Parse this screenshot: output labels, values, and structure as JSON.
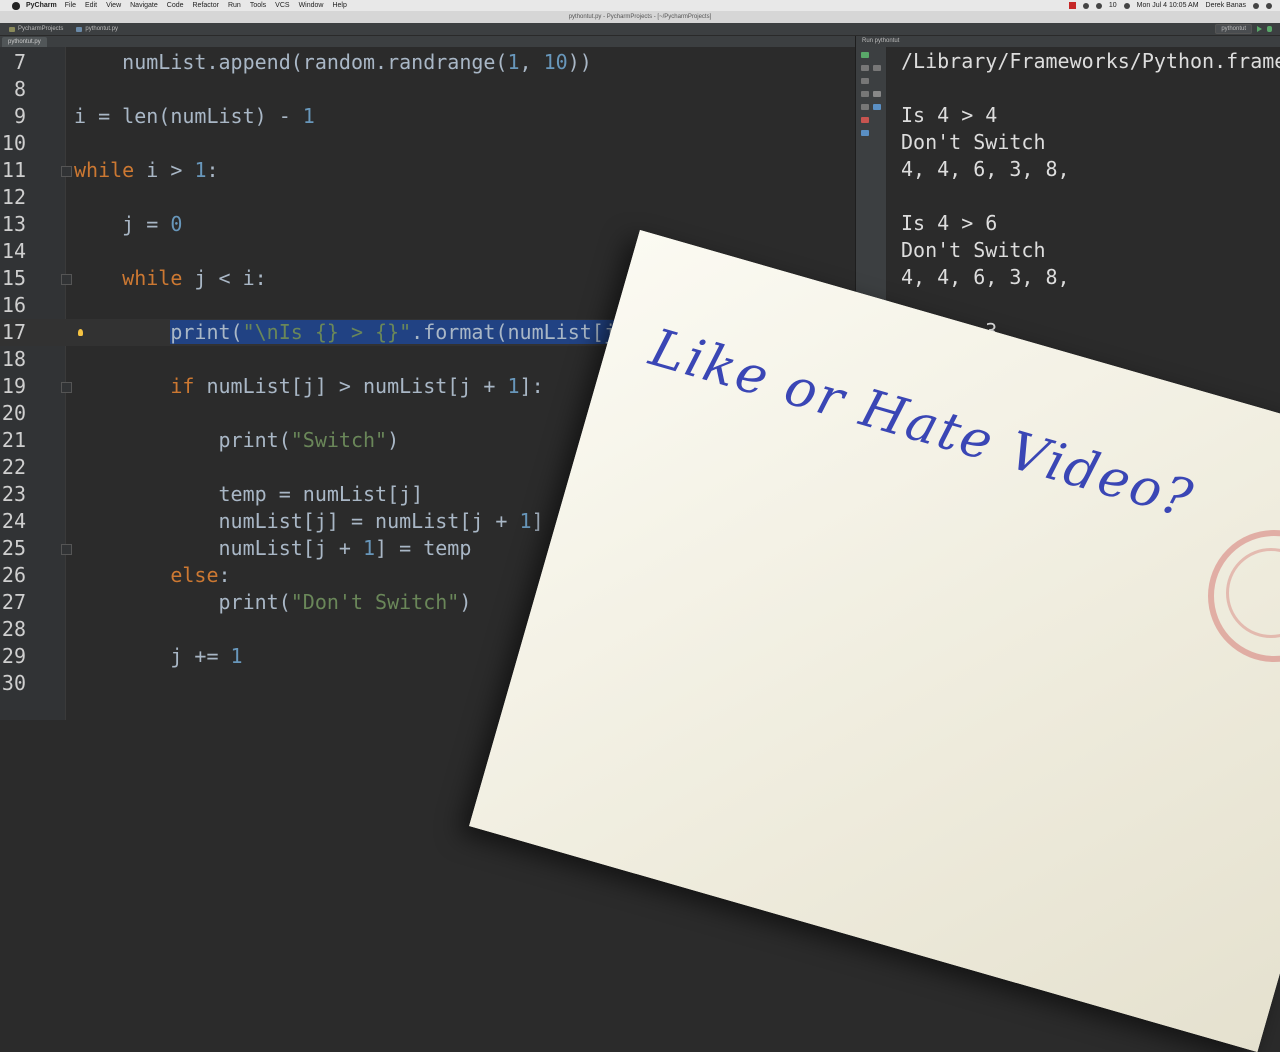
{
  "menubar": {
    "app": "PyCharm",
    "items": [
      "File",
      "Edit",
      "View",
      "Navigate",
      "Code",
      "Refactor",
      "Run",
      "Tools",
      "VCS",
      "Window",
      "Help"
    ],
    "battery": "10",
    "clock": "Mon Jul 4  10:05 AM",
    "user": "Derek Banas"
  },
  "window": {
    "title": "pythontut.py - PycharmProjects - [~/PycharmProjects]"
  },
  "navbar": {
    "crumbs": [
      "PycharmProjects",
      "pythontut.py"
    ],
    "run_config": "pythontut"
  },
  "tabs": {
    "active": "pythontut.py"
  },
  "editor": {
    "lines": [
      {
        "n": "7"
      },
      {
        "n": "8"
      },
      {
        "n": "9"
      },
      {
        "n": "10"
      },
      {
        "n": "11"
      },
      {
        "n": "12"
      },
      {
        "n": "13"
      },
      {
        "n": "14"
      },
      {
        "n": "15"
      },
      {
        "n": "16"
      },
      {
        "n": "17"
      },
      {
        "n": "18"
      },
      {
        "n": "19"
      },
      {
        "n": "20"
      },
      {
        "n": "21"
      },
      {
        "n": "22"
      },
      {
        "n": "23"
      },
      {
        "n": "24"
      },
      {
        "n": "25"
      },
      {
        "n": "26"
      },
      {
        "n": "27"
      },
      {
        "n": "28"
      },
      {
        "n": "29"
      },
      {
        "n": "30"
      }
    ],
    "code": {
      "l7_a": "    numList.append(random.randrange(",
      "l7_n1": "1",
      "l7_b": ", ",
      "l7_n2": "10",
      "l7_c": "))",
      "l9_a": "i = len(numList) - ",
      "l9_n": "1",
      "l11_kw": "while",
      "l11_a": " i > ",
      "l11_n": "1",
      "l11_b": ":",
      "l13_a": "    j = ",
      "l13_n": "0",
      "l15_kw": "    while",
      "l15_a": " j < i:",
      "l17_indent": "        ",
      "l17_a": "print(",
      "l17_s": "\"\\nIs {} > {}\"",
      "l17_b": ".format(numList[j]",
      "l19_kw": "        if",
      "l19_a": " numList[j] > numList[j + ",
      "l19_n": "1",
      "l19_b": "]:",
      "l21_a": "            print(",
      "l21_s": "\"Switch\"",
      "l21_b": ")",
      "l23_a": "            temp = numList[j]",
      "l24_a": "            numList[j] = numList[j + ",
      "l24_n": "1",
      "l24_b": "]",
      "l25_a": "            numList[j + ",
      "l25_n": "1",
      "l25_b": "] = temp",
      "l26_kw": "        else",
      "l26_a": ":",
      "l27_a": "            print(",
      "l27_s": "\"Don't Switch\"",
      "l27_b": ")",
      "l29_a": "        j += ",
      "l29_n": "1"
    }
  },
  "run": {
    "header": "Run   pythontut",
    "output": [
      "/Library/Frameworks/Python.frame",
      "",
      "Is 4 > 4",
      "Don't Switch",
      "4, 4, 6, 3, 8,",
      "",
      "Is 4 > 6",
      "Don't Switch",
      "4, 4, 6, 3, 8,",
      "",
      "Is 6 > 3"
    ]
  },
  "overlay": {
    "text": "Like or Hate Video?"
  }
}
